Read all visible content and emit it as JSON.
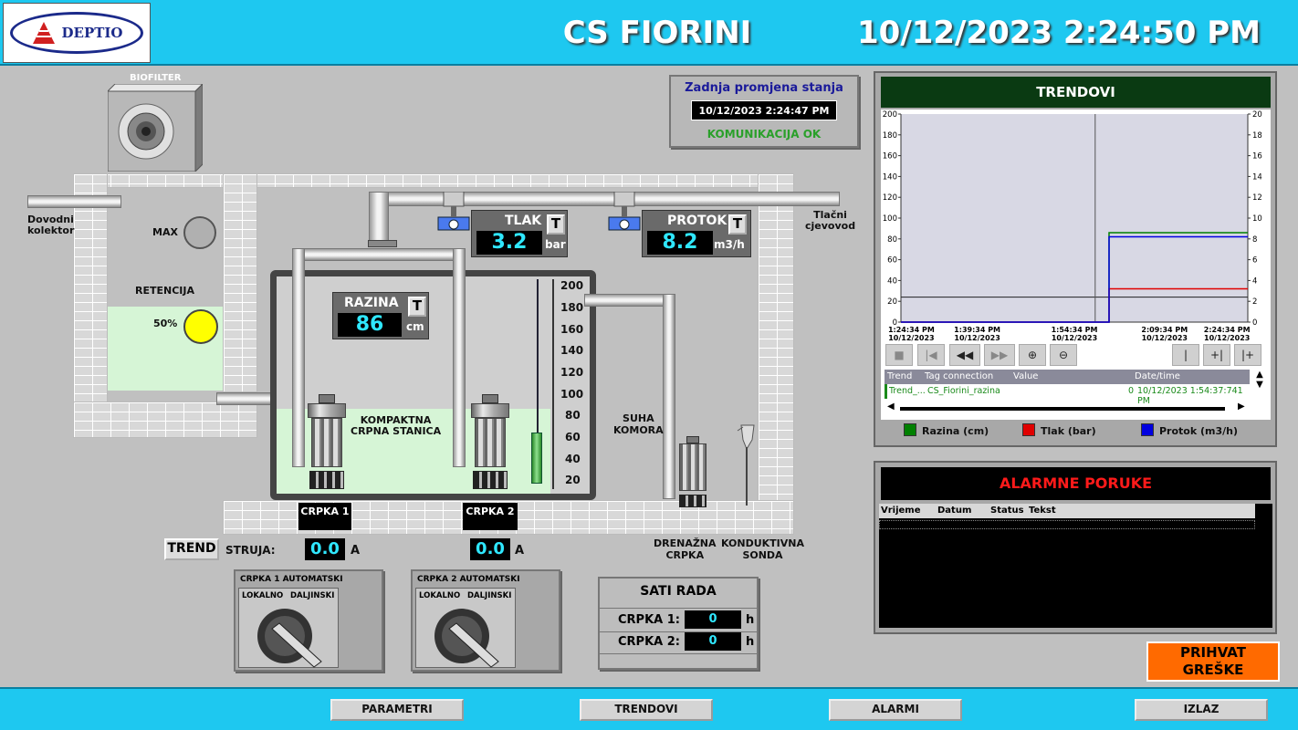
{
  "header": {
    "logo_text": "DEPTIO",
    "title": "CS FIORINI",
    "datetime": "10/12/2023 2:24:50 PM"
  },
  "biofilter": {
    "label": "BIOFILTER"
  },
  "status": {
    "title": "Zadnja promjena stanja",
    "timestamp": "10/12/2023 2:24:47 PM",
    "comm": "KOMUNIKACIJA OK"
  },
  "labels": {
    "dovodni": "Dovodni\nkolektor",
    "tlacni": "Tlačni\ncjevovod",
    "max": "MAX",
    "retencija": "RETENCIJA",
    "percent": "50%",
    "kompaktna": "KOMPAKTNA\nCRPNA STANICA",
    "suha": "SUHA\nKOMORA",
    "drenazna": "DRENAŽNA\nCRPKA",
    "konduktivna": "KONDUKTIVNA\nSONDA"
  },
  "tlak": {
    "label": "TLAK",
    "value": "3.2",
    "unit": "bar",
    "t": "T"
  },
  "protok": {
    "label": "PROTOK",
    "value": "8.2",
    "unit": "m3/h",
    "t": "T"
  },
  "razina": {
    "label": "RAZINA",
    "value": "86",
    "unit": "cm",
    "t": "T"
  },
  "scale": [
    "200",
    "180",
    "160",
    "140",
    "120",
    "100",
    "80",
    "60",
    "40",
    "20"
  ],
  "pumps": {
    "c1": "CRPKA 1",
    "c2": "CRPKA 2"
  },
  "current": {
    "trend": "TREND",
    "label": "STRUJA:",
    "c1": "0.0",
    "c2": "0.0",
    "unit": "A"
  },
  "switch1": {
    "title": "CRPKA 1  AUTOMATSKI",
    "lokalno": "LOKALNO",
    "daljinski": "DALJINSKI"
  },
  "switch2": {
    "title": "CRPKA 2  AUTOMATSKI",
    "lokalno": "LOKALNO",
    "daljinski": "DALJINSKI"
  },
  "hours": {
    "title": "SATI RADA",
    "c1_label": "CRPKA 1:",
    "c1_value": "0",
    "c2_label": "CRPKA 2:",
    "c2_value": "0",
    "unit": "h"
  },
  "trend": {
    "title": "TRENDOVI",
    "left_axis": [
      "200",
      "180",
      "160",
      "140",
      "120",
      "100",
      "80",
      "60",
      "40",
      "20",
      "0"
    ],
    "right_axis": [
      "20",
      "18",
      "16",
      "14",
      "12",
      "10",
      "8",
      "6",
      "4",
      "2",
      "0"
    ],
    "x_labels": [
      {
        "t": "1:24:34 PM",
        "d": "10/12/2023"
      },
      {
        "t": "1:39:34 PM",
        "d": "10/12/2023"
      },
      {
        "t": "1:54:34 PM",
        "d": "10/12/2023"
      },
      {
        "t": "2:09:34 PM",
        "d": "10/12/2023"
      },
      {
        "t": "2:24:34 PM",
        "d": "10/12/2023"
      }
    ],
    "table_headers": {
      "trend": "Trend",
      "tag": "Tag connection",
      "value": "Value",
      "dt": "Date/time"
    },
    "table_row": {
      "trend": "Trend_...",
      "tag": "CS_Fiorini_razina",
      "value": "0",
      "dt": "10/12/2023 1:54:37:741 PM"
    },
    "legend": [
      {
        "name": "Razina (cm)",
        "color": "#008000"
      },
      {
        "name": "Tlak (bar)",
        "color": "#e00000"
      },
      {
        "name": "Protok (m3/h)",
        "color": "#0000e0"
      }
    ]
  },
  "chart_data": {
    "type": "line",
    "xlabel": "",
    "ylabel": "",
    "ylim": [
      0,
      200
    ],
    "y2lim": [
      0,
      20
    ],
    "x": [
      "1:24:34 PM",
      "1:39:34 PM",
      "1:54:34 PM",
      "2:09:34 PM",
      "2:24:34 PM"
    ],
    "series": [
      {
        "name": "Razina (cm)",
        "axis": "left",
        "color": "#008000",
        "points": [
          [
            0,
            0
          ],
          [
            0.6,
            0
          ],
          [
            0.6,
            86
          ],
          [
            1,
            86
          ]
        ]
      },
      {
        "name": "Tlak (bar)",
        "axis": "right",
        "color": "#e00000",
        "points": [
          [
            0,
            0
          ],
          [
            0.6,
            0
          ],
          [
            0.6,
            3.2
          ],
          [
            1,
            3.2
          ]
        ]
      },
      {
        "name": "Protok (m3/h)",
        "axis": "right",
        "color": "#0000e0",
        "points": [
          [
            0,
            0
          ],
          [
            0.6,
            0
          ],
          [
            0.6,
            8.2
          ],
          [
            1,
            8.2
          ]
        ]
      }
    ],
    "reference_line": 24
  },
  "alarms": {
    "title": "ALARMNE PORUKE",
    "headers": {
      "vrijeme": "Vrijeme",
      "datum": "Datum",
      "status": "Status",
      "tekst": "Tekst"
    }
  },
  "ack": {
    "label": "PRIHVAT\nGREŠKE"
  },
  "nav": {
    "parametri": "PARAMETRI",
    "trendovi": "TRENDOVI",
    "alarmi": "ALARMI",
    "izlaz": "IZLAZ"
  }
}
